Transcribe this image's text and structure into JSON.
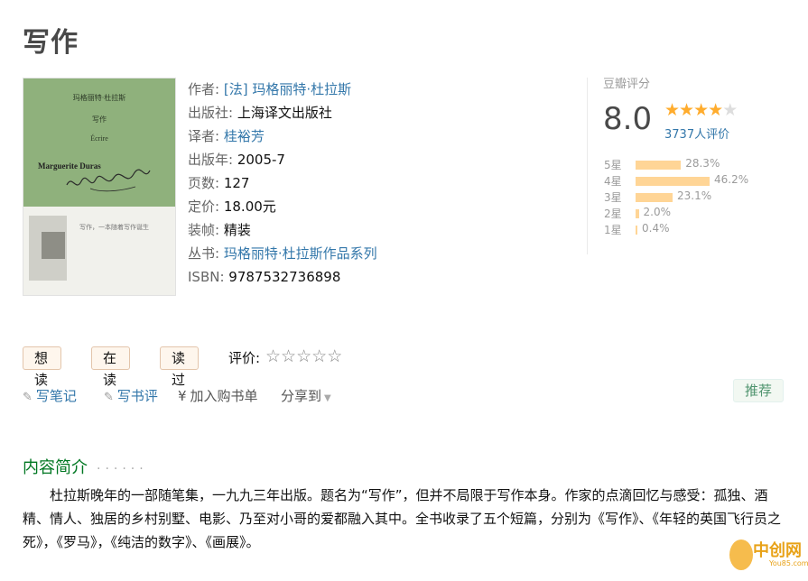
{
  "title": "写作",
  "cover": {
    "top_line": "玛格丽特·杜拉斯",
    "title_cn": "写作",
    "title_fr": "Écrire",
    "author": "Marguerite Duras",
    "caption": "写作，一本随着写作诞生"
  },
  "info": {
    "author_label": "作者:",
    "author": "[法] 玛格丽特·杜拉斯",
    "publisher_label": "出版社:",
    "publisher": "上海译文出版社",
    "translator_label": "译者:",
    "translator": "桂裕芳",
    "year_label": "出版年:",
    "year": "2005-7",
    "pages_label": "页数:",
    "pages": "127",
    "price_label": "定价:",
    "price": "18.00元",
    "binding_label": "装帧:",
    "binding": "精装",
    "series_label": "丛书:",
    "series": "玛格丽特·杜拉斯作品系列",
    "isbn_label": "ISBN:",
    "isbn": "9787532736898"
  },
  "rating": {
    "title": "豆瓣评分",
    "score": "8.0",
    "stars_filled": 4,
    "stars_total": 5,
    "count": "3737人评价",
    "distribution": [
      {
        "label": "5星",
        "pct": "28.3%",
        "value": 28.3
      },
      {
        "label": "4星",
        "pct": "46.2%",
        "value": 46.2
      },
      {
        "label": "3星",
        "pct": "23.1%",
        "value": 23.1
      },
      {
        "label": "2星",
        "pct": "2.0%",
        "value": 2.0
      },
      {
        "label": "1星",
        "pct": "0.4%",
        "value": 0.4
      }
    ],
    "bar_color": "#ffd596",
    "star_color": "#ffac2d"
  },
  "actions": {
    "want": "想读",
    "reading": "在读",
    "read": "读过",
    "rate_label": "评价:",
    "note": "写笔记",
    "review": "写书评",
    "cart": "加入购书单",
    "share": "分享到",
    "recommend": "推荐"
  },
  "intro": {
    "title": "内容简介",
    "dots": "······",
    "text": "杜拉斯晚年的一部随笔集，一九九三年出版。题名为“写作”，但并不局限于写作本身。作家的点滴回忆与感受：孤独、酒精、情人、独居的乡村别墅、电影、乃至对小哥的爱都融入其中。全书收录了五个短篇，分别为《写作》、《年轻的英国飞行员之死》，《罗马》，《纯洁的数字》、《画展》。"
  },
  "watermark": {
    "text": "中创网",
    "sub": "You85.com"
  }
}
